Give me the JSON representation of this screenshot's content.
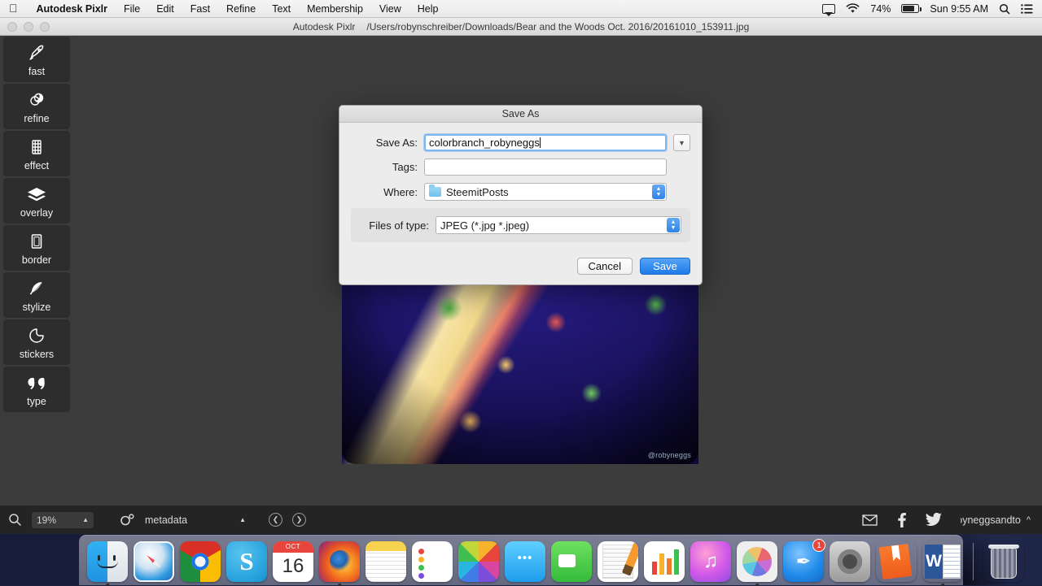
{
  "menubar": {
    "apple_icon": "apple-icon",
    "items": [
      {
        "label": "Autodesk Pixlr",
        "bold": true
      },
      {
        "label": "File"
      },
      {
        "label": "Edit"
      },
      {
        "label": "Fast"
      },
      {
        "label": "Refine"
      },
      {
        "label": "Text"
      },
      {
        "label": "Membership"
      },
      {
        "label": "View"
      },
      {
        "label": "Help"
      }
    ],
    "status": {
      "airplay_icon": "airplay-icon",
      "wifi_icon": "wifi-icon",
      "battery_percent": "74%",
      "battery_icon": "battery-icon",
      "clock": "Sun 9:55 AM",
      "search_icon": "spotlight-search-icon",
      "notifications_icon": "notification-center-icon"
    }
  },
  "window": {
    "app_name": "Autodesk Pixlr",
    "file_path": "/Users/robynschreiber/Downloads/Bear and the Woods Oct. 2016/20161010_153911.jpg"
  },
  "sidebar": {
    "tools": [
      {
        "label": "fast",
        "icon": "rocket-icon"
      },
      {
        "label": "refine",
        "icon": "adjust-circles-icon"
      },
      {
        "label": "effect",
        "icon": "film-strip-icon"
      },
      {
        "label": "overlay",
        "icon": "layers-icon"
      },
      {
        "label": "border",
        "icon": "frame-icon"
      },
      {
        "label": "stylize",
        "icon": "feather-icon"
      },
      {
        "label": "stickers",
        "icon": "sticker-icon"
      },
      {
        "label": "type",
        "icon": "quote-marks-icon"
      }
    ]
  },
  "canvas": {
    "photo_watermark": "@robyneggs"
  },
  "dialog": {
    "title": "Save As",
    "fields": {
      "save_as_label": "Save As:",
      "save_as_value": "colorbranch_robyneggs",
      "save_as_placeholder": "",
      "disclosure_icon": "chevron-down-icon",
      "tags_label": "Tags:",
      "tags_value": "",
      "tags_placeholder": "",
      "where_label": "Where:",
      "where_value": "SteemitPosts",
      "where_folder_icon": "folder-icon",
      "filetype_label": "Files of type:",
      "filetype_value": "JPEG (*.jpg *.jpeg)"
    },
    "buttons": {
      "cancel": "Cancel",
      "save": "Save"
    },
    "accent_color": "#1e7ae8"
  },
  "statusbar": {
    "search_icon": "search-icon",
    "zoom_value": "19%",
    "zoom_caret_icon": "caret-up-icon",
    "metadata_icon": "metadata-icon",
    "metadata_label": "metadata",
    "metadata_caret_icon": "caret-up-icon",
    "prev_icon": "chevron-left-icon",
    "next_icon": "chevron-right-icon",
    "mail_icon": "envelope-icon",
    "facebook_icon": "facebook-icon",
    "twitter_icon": "twitter-icon",
    "account_name": "oyneggsandto",
    "account_caret_icon": "caret-up-icon"
  },
  "dock": {
    "items": [
      {
        "name": "finder",
        "label": "Finder",
        "running": true
      },
      {
        "name": "safari",
        "label": "Safari",
        "running": false
      },
      {
        "name": "chrome",
        "label": "Google Chrome",
        "running": false
      },
      {
        "name": "skype",
        "label": "Skype",
        "running": false,
        "letter": "S"
      },
      {
        "name": "calendar",
        "label": "Calendar",
        "running": false,
        "month": "OCT",
        "day": "16"
      },
      {
        "name": "firefox",
        "label": "Firefox",
        "running": true
      },
      {
        "name": "notes",
        "label": "Notes",
        "running": false
      },
      {
        "name": "reminders",
        "label": "Reminders",
        "running": false
      },
      {
        "name": "photos",
        "label": "Photos",
        "running": false
      },
      {
        "name": "messages",
        "label": "Messages",
        "running": false
      },
      {
        "name": "facetime",
        "label": "FaceTime",
        "running": false
      },
      {
        "name": "pages",
        "label": "Pages",
        "running": false
      },
      {
        "name": "numbers",
        "label": "Numbers",
        "running": false
      },
      {
        "name": "itunes",
        "label": "iTunes",
        "running": false,
        "glyph": "♫"
      },
      {
        "name": "pixlr",
        "label": "Autodesk Pixlr",
        "running": true
      },
      {
        "name": "app-store",
        "label": "App Store",
        "running": false,
        "badge": "1",
        "glyph": "✒"
      },
      {
        "name": "system-preferences",
        "label": "System Preferences",
        "running": false
      },
      {
        "name": "ibooks",
        "label": "iBooks",
        "running": false
      },
      {
        "name": "word",
        "label": "Microsoft Word",
        "running": true,
        "letter": "W"
      },
      {
        "name": "trash",
        "label": "Trash",
        "running": false
      }
    ]
  }
}
